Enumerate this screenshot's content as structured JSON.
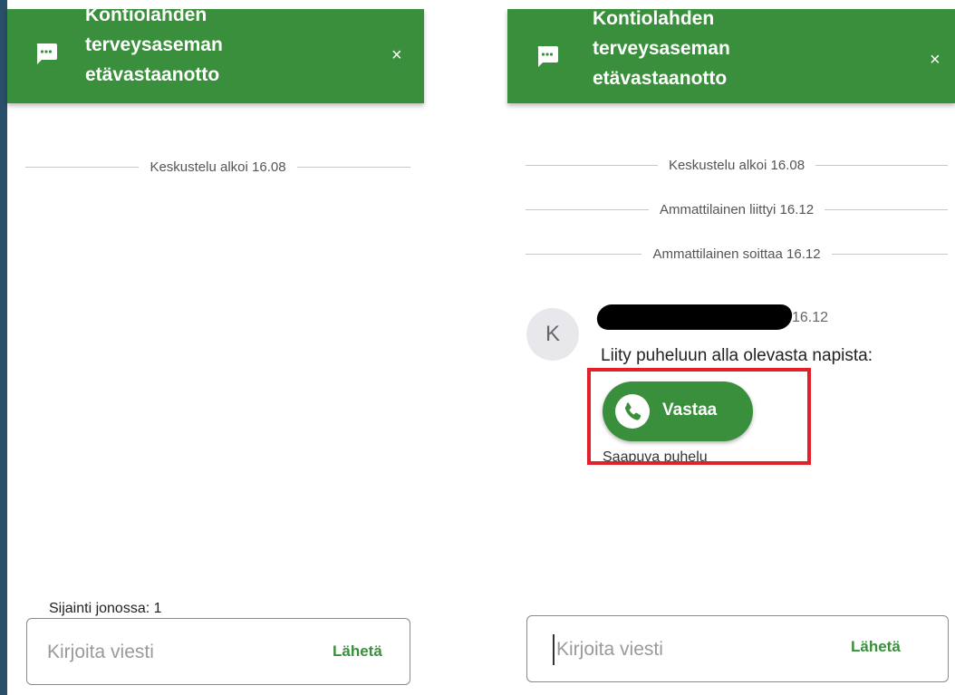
{
  "chat": {
    "title_lines": [
      "Kontiolahden",
      "terveysaseman",
      "etävastaanotto"
    ],
    "close_label": "×",
    "chat_icon": "chat-bubble-icon"
  },
  "left": {
    "started": "Keskustelu alkoi 16.08",
    "queue": "Sijainti jonossa: 1",
    "placeholder": "Kirjoita viesti",
    "send": "Lähetä"
  },
  "right": {
    "started": "Keskustelu alkoi 16.08",
    "joined": "Ammattilainen liittyi 16.12",
    "calling": "Ammattilainen soittaa 16.12",
    "avatar_initial": "K",
    "message_time": "16.12",
    "message_text": "Liity puheluun alla olevasta napista:",
    "answer": "Vastaa",
    "incoming": "Saapuva puhelu",
    "placeholder": "Kirjoita viesti",
    "send": "Lähetä"
  },
  "colors": {
    "brand": "#3a8f3c",
    "highlight": "#e3202a"
  }
}
